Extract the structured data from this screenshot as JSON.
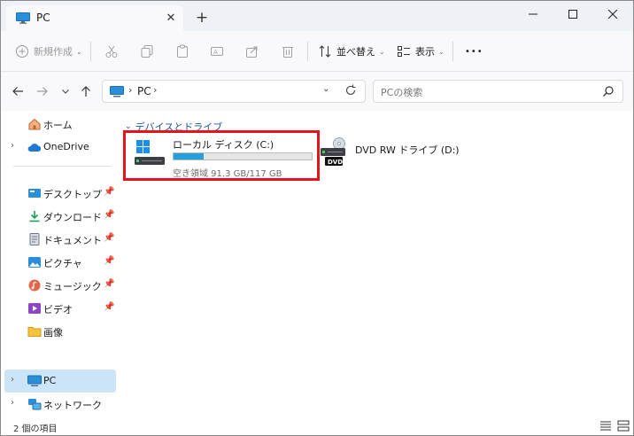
{
  "window": {
    "tab_title": "PC",
    "new_tab_symbol": "+",
    "tab_close_symbol": "✕"
  },
  "toolbar": {
    "new_label": "新規作成",
    "sort_label": "並べ替え",
    "view_label": "表示",
    "more_symbol": "•••"
  },
  "nav": {
    "address_text": "PC",
    "search_placeholder": "PCの検索"
  },
  "sidebar": {
    "items": [
      {
        "label": "ホーム",
        "icon": "home-icon"
      },
      {
        "label": "OneDrive",
        "icon": "cloud-icon"
      },
      {
        "label": "デスクトップ",
        "icon": "desktop-icon"
      },
      {
        "label": "ダウンロード",
        "icon": "download-icon"
      },
      {
        "label": "ドキュメント",
        "icon": "document-icon"
      },
      {
        "label": "ピクチャ",
        "icon": "pictures-icon"
      },
      {
        "label": "ミュージック",
        "icon": "music-icon"
      },
      {
        "label": "ビデオ",
        "icon": "video-icon"
      },
      {
        "label": "画像",
        "icon": "folder-icon"
      },
      {
        "label": "PC",
        "icon": "pc-icon"
      },
      {
        "label": "ネットワーク",
        "icon": "network-icon"
      }
    ]
  },
  "content": {
    "group_label": "デバイスとドライブ",
    "drives": [
      {
        "name": "ローカル ディスク (C:)",
        "free_text": "空き領域 91.3 GB/117 GB",
        "used_fraction": 0.22
      },
      {
        "name": "DVD RW ドライブ (D:)",
        "badge": "DVD"
      }
    ]
  },
  "status": {
    "item_count": "2 個の項目"
  },
  "colors": {
    "accent": "#26a0da",
    "highlight_box": "#e3141c",
    "selected_bg": "#cce4f7",
    "group_header": "#1a56a0"
  }
}
